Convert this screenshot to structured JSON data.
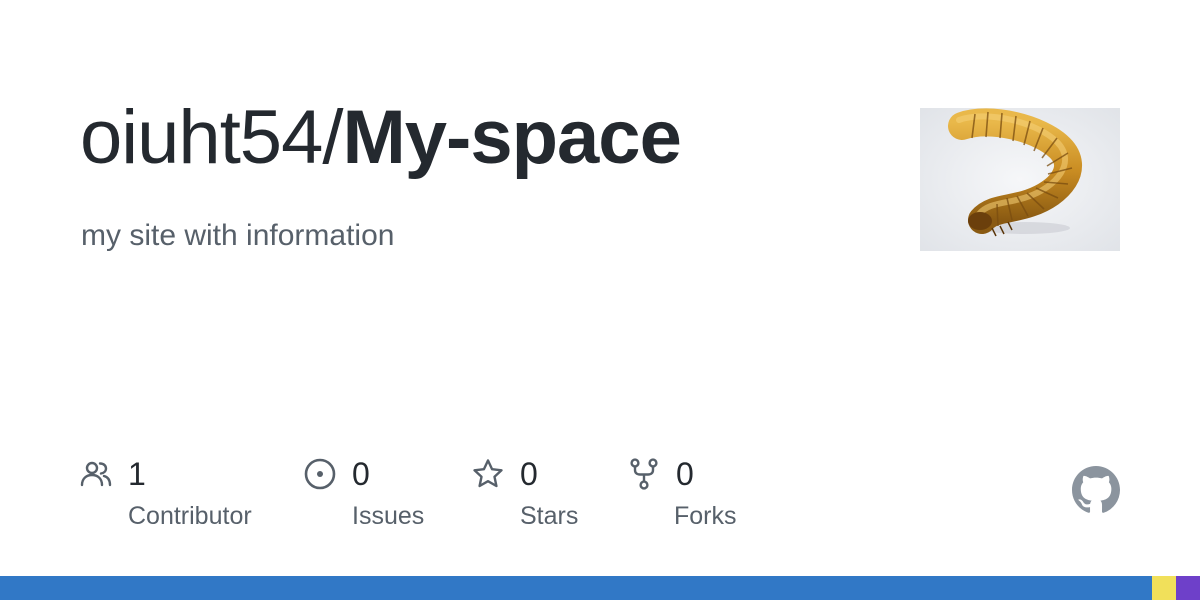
{
  "repo": {
    "owner": "oiuht54/",
    "name": "My-space",
    "description": "my site with information"
  },
  "avatar": {
    "icon": "mealworm-photo"
  },
  "stats": [
    {
      "icon": "people-icon",
      "value": "1",
      "label": "Contributor"
    },
    {
      "icon": "issue-icon",
      "value": "0",
      "label": "Issues"
    },
    {
      "icon": "star-icon",
      "value": "0",
      "label": "Stars"
    },
    {
      "icon": "fork-icon",
      "value": "0",
      "label": "Forks"
    }
  ],
  "brand": {
    "logo": "github-icon"
  },
  "colors": {
    "text": "#24292f",
    "muted": "#57606a",
    "icon": "#57606a",
    "lang_primary": "#3178c6",
    "lang_secondary": "#f1e05a",
    "lang_tertiary": "#6e40c9"
  }
}
